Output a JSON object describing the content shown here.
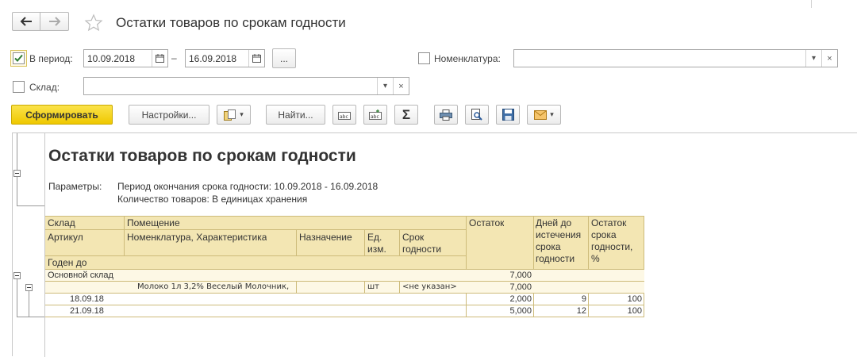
{
  "window": {
    "title": "Остатки товаров по срокам годности"
  },
  "nav": {
    "back_icon": "arrow-left-icon",
    "forward_icon": "arrow-right-icon",
    "favorite_icon": "star-icon"
  },
  "filters": {
    "period_label": "В период:",
    "period_checked": true,
    "date_from": "10.09.2018",
    "date_sep": "–",
    "date_to": "16.09.2018",
    "select_period_label": "...",
    "nomenclature_label": "Номенклатура:",
    "nomenclature_value": "",
    "warehouse_label": "Склад:",
    "warehouse_value": "",
    "warehouse_checked": false,
    "nomenclature_checked": false
  },
  "toolbar": {
    "generate_label": "Сформировать",
    "settings_label": "Настройки...",
    "find_label": "Найти...",
    "sum_label": "Σ"
  },
  "report": {
    "title": "Остатки товаров по срокам годности",
    "params_label": "Параметры:",
    "param_period": "Период окончания срока годности: 10.09.2018 - 16.09.2018",
    "param_quantity": "Количество товаров: В единицах хранения",
    "headers": {
      "warehouse": "Склад",
      "room": "Помещение",
      "article": "Артикул",
      "nomenclature": "Номенклатура, Характеристика",
      "purpose": "Назначение",
      "unit": "Ед. изм.",
      "shelf_life": "Срок годности",
      "valid_until": "Годен до",
      "balance": "Остаток",
      "days_to_expiry": "Дней до истечения срока годности",
      "shelf_life_balance": "Остаток срока годности, %"
    },
    "rows": {
      "group": {
        "name": "Основной склад",
        "balance": "7,000"
      },
      "item": {
        "name": "Молоко 1л 3,2% Веселый Молочник,",
        "unit": "шт",
        "shelf_life": "<не указан>",
        "balance": "7,000"
      },
      "dates": [
        {
          "date": "18.09.18",
          "balance": "2,000",
          "days": "9",
          "percent": "100"
        },
        {
          "date": "21.09.18",
          "balance": "5,000",
          "days": "12",
          "percent": "100"
        }
      ]
    }
  },
  "colors": {
    "generate_button": "#f5d20a",
    "header_fill": "#f3e6b3",
    "grid_line": "#cdbb7a"
  }
}
